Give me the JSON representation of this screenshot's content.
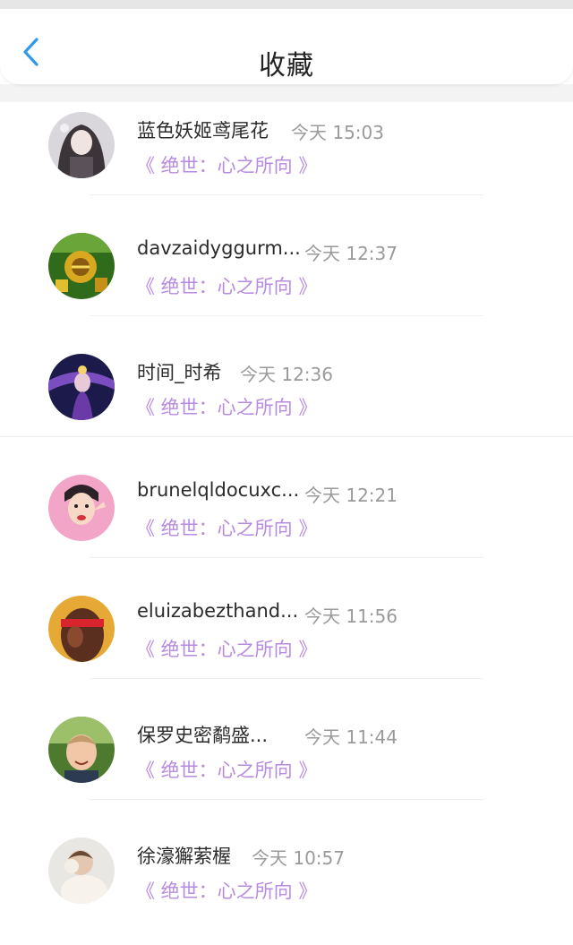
{
  "header": {
    "title": "收藏"
  },
  "items": [
    {
      "name": "蓝色妖姬鸢尾花",
      "time": "今天 15:03",
      "work": "《 绝世：心之所向 》"
    },
    {
      "name": "davzaidyggurm...",
      "time": "今天 12:37",
      "work": "《 绝世：心之所向 》"
    },
    {
      "name": "时间_时希",
      "time": "今天 12:36",
      "work": "《 绝世：心之所向 》"
    },
    {
      "name": "brunelqldocuxc...",
      "time": "今天 12:21",
      "work": "《 绝世：心之所向 》"
    },
    {
      "name": "eluizabezthand...",
      "time": "今天 11:56",
      "work": "《 绝世：心之所向 》"
    },
    {
      "name": "保罗史密鹬盛...",
      "time": "今天 11:44",
      "work": "《 绝世：心之所向 》"
    },
    {
      "name": "徐濠獬萦楃",
      "time": "今天 10:57",
      "work": "《 绝世：心之所向 》"
    }
  ],
  "colors": {
    "accent_blue": "#2f9be8",
    "work_purple": "#b78be0",
    "time_gray": "#9a9a9a"
  }
}
